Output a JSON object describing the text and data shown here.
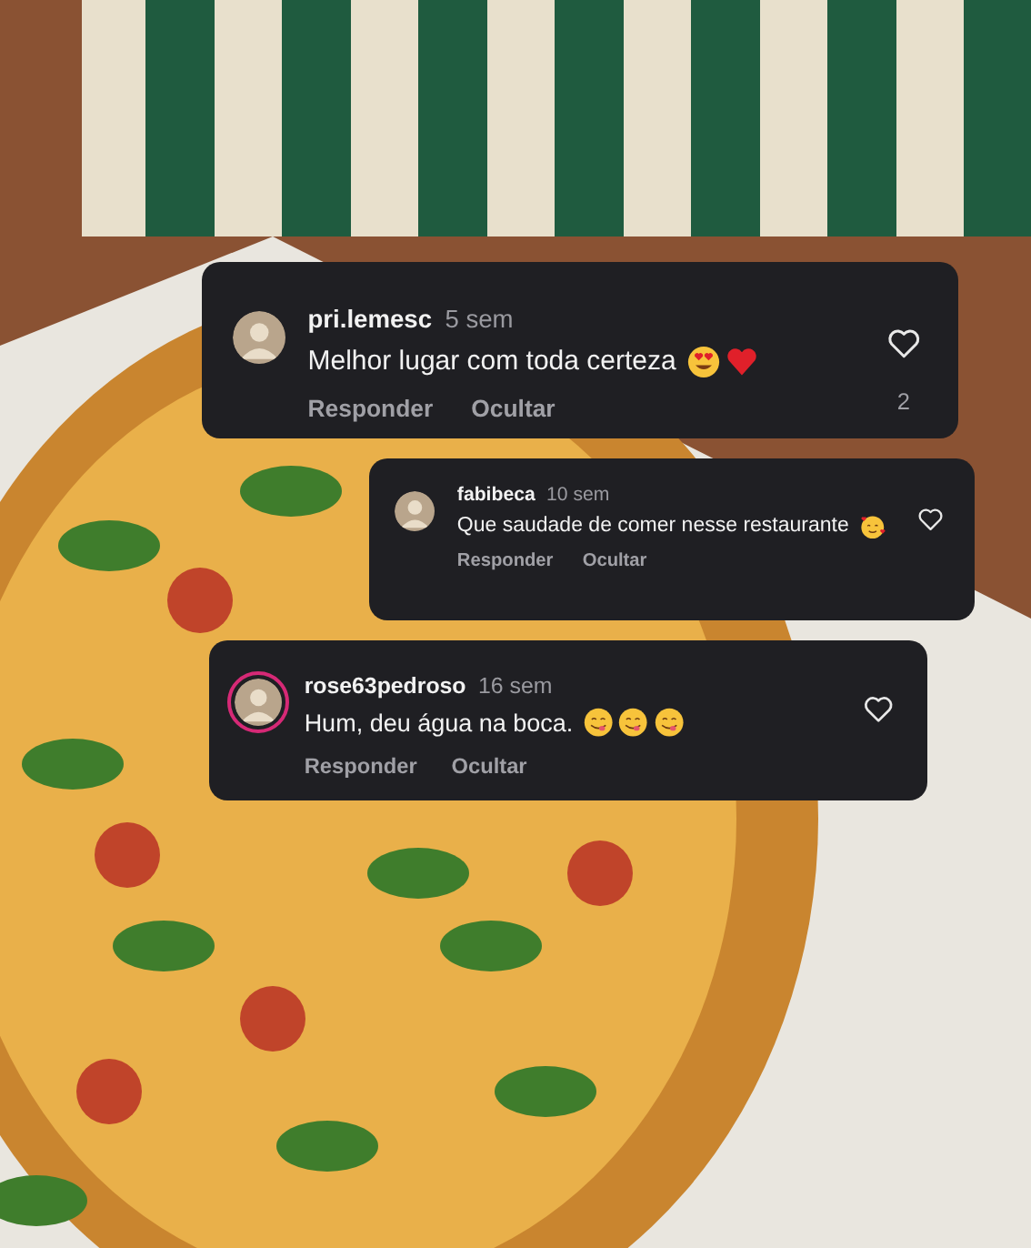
{
  "comments": [
    {
      "username": "pri.lemesc",
      "time": "5 sem",
      "text": "Melhor lugar com toda certeza",
      "emojis": [
        {
          "kind": "heart-eyes"
        },
        {
          "kind": "heart"
        }
      ],
      "story_ring": false,
      "like_count": "2",
      "actions": [
        "Responder",
        "Ocultar"
      ]
    },
    {
      "username": "fabibeca",
      "time": "10 sem",
      "text": "Que saudade de comer nesse restaurante",
      "emojis": [
        {
          "kind": "hearts-face"
        }
      ],
      "story_ring": false,
      "actions": [
        "Responder",
        "Ocultar"
      ]
    },
    {
      "username": "rose63pedroso",
      "time": "16 sem",
      "text": "Hum, deu água na boca.",
      "emojis": [
        {
          "kind": "yum"
        },
        {
          "kind": "yum"
        },
        {
          "kind": "yum"
        }
      ],
      "story_ring": true,
      "actions": [
        "Responder",
        "Ocultar"
      ]
    }
  ]
}
